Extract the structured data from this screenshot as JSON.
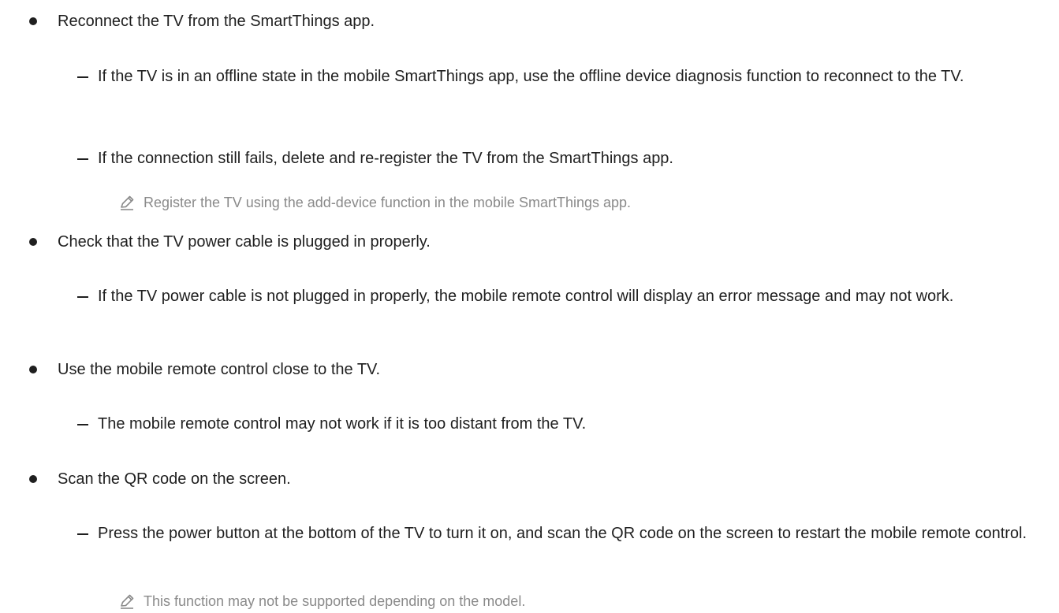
{
  "bullets": [
    {
      "text": "Reconnect the TV from the SmartThings app.",
      "subitems": [
        "If the TV is in an offline state in the mobile SmartThings app, use the offline device diagnosis function to reconnect to the TV.",
        "If the connection still fails, delete and re-register the TV from the SmartThings app."
      ],
      "note": "Register the TV using the add-device function in the mobile SmartThings app."
    },
    {
      "text": "Check that the TV power cable is plugged in properly.",
      "subitems": [
        "If the TV power cable is not plugged in properly, the mobile remote control will display an error message and may not work."
      ]
    },
    {
      "text": "Use the mobile remote control close to the TV.",
      "subitems": [
        "The mobile remote control may not work if it is too distant from the TV."
      ]
    },
    {
      "text": "Scan the QR code on the screen.",
      "subitems": [
        "Press the power button at the bottom of the TV to turn it on, and scan the QR code on the screen to restart the mobile remote control."
      ],
      "note": "This function may not be supported depending on the model."
    }
  ],
  "icons": {
    "note": "pencil-icon"
  },
  "colors": {
    "text": "#1f1f1f",
    "note_text": "#8a8a8a",
    "background": "#ffffff"
  }
}
